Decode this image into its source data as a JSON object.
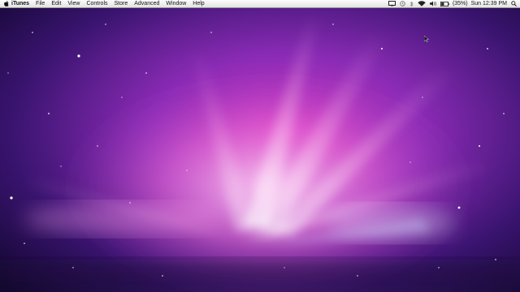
{
  "menubar": {
    "app_name": "iTunes",
    "menus": [
      "File",
      "Edit",
      "View",
      "Controls",
      "Store",
      "Advanced",
      "Window",
      "Help"
    ],
    "status": {
      "battery_percent": "(35%)",
      "clock": "Sun 12:39 PM",
      "icons": [
        "screen-mirror-icon",
        "time-machine-icon",
        "bluetooth-icon",
        "wifi-icon",
        "volume-icon",
        "battery-icon",
        "spotlight-icon"
      ]
    }
  },
  "desktop": {
    "wallpaper": "aurora-galaxy",
    "colors": {
      "deep": "#1b0b45",
      "purple": "#6a1fa8",
      "magenta": "#e040c8",
      "pink_glow": "#ffb0f0"
    }
  }
}
